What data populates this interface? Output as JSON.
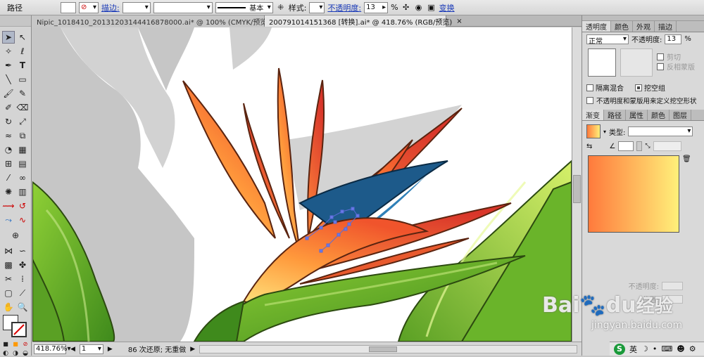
{
  "control_bar": {
    "object_type": "路径",
    "stroke_label": "描边:",
    "stroke_profile": "基本",
    "style_label": "样式:",
    "opacity_label": "不透明度:",
    "opacity_value": "13",
    "opacity_unit": "%",
    "transform_label": "变换"
  },
  "tabs": [
    {
      "label": "Nipic_1018410_20131203144416878000.ai* @ 100% (CMYK/预览)",
      "close": "×"
    },
    {
      "label": "2007910141513​68 [转换].ai* @ 418.76% (RGB/预览)",
      "close": "×"
    }
  ],
  "status": {
    "zoom": "418.76%",
    "page": "1",
    "info": "86 次还原; 无重做"
  },
  "transparency_panel": {
    "tabs": [
      "透明度",
      "颜色",
      "外观",
      "描边"
    ],
    "blend_mode": "正常",
    "opacity_label": "不透明度:",
    "opacity_value": "13",
    "opacity_unit": "%",
    "clip_label": "剪切",
    "invert_mask_label": "反相蒙版",
    "isolate_label": "隔离混合",
    "knockout_label": "挖空组",
    "define_knockout_label": "不透明度和蒙版用来定义挖空形状"
  },
  "gradient_panel": {
    "tabs": [
      "渐变",
      "路径",
      "属性",
      "颜色",
      "图层"
    ],
    "type_label": "类型:",
    "opacity_label": "不透明度:",
    "location_label": "位置:",
    "gradient_start": "#ff7a3c",
    "gradient_end": "#fff07a"
  },
  "watermark": {
    "brand": "Bai",
    "brand2": "du",
    "text": "经验",
    "url": "jingyan.baidu.com"
  },
  "taskbar": {
    "ime_label": "英"
  },
  "icons": [
    "selection-icon",
    "direct-selection-icon",
    "magic-wand-icon",
    "lasso-icon",
    "pen-icon",
    "type-icon",
    "line-icon",
    "rectangle-icon",
    "paintbrush-icon",
    "pencil-icon",
    "rotate-icon",
    "scale-icon",
    "gradient-icon",
    "eyedropper-icon",
    "hand-icon",
    "zoom-icon"
  ]
}
